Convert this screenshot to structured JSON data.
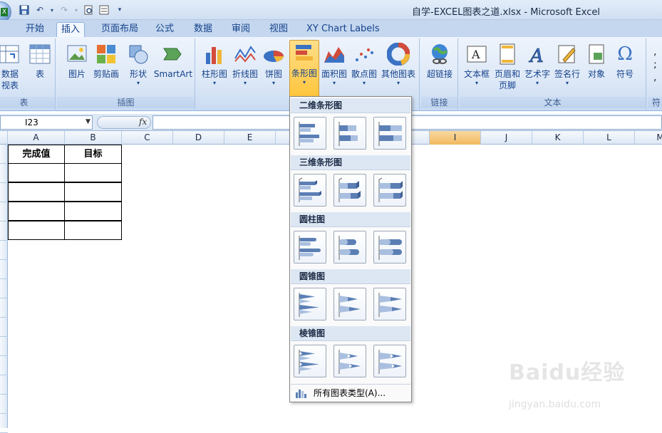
{
  "window": {
    "title": "自学-EXCEL图表之道.xlsx - Microsoft Excel"
  },
  "tabs": [
    "开始",
    "插入",
    "页面布局",
    "公式",
    "数据",
    "审阅",
    "视图",
    "XY Chart Labels"
  ],
  "active_tab": "插入",
  "ribbon": {
    "groups": {
      "table": "表",
      "illustrations": "插图",
      "links": "链接",
      "text": "文本"
    },
    "buttons": {
      "pivot_line1": "数据",
      "pivot_line2": "视表",
      "table": "表",
      "picture": "图片",
      "clipart": "剪贴画",
      "shapes": "形状",
      "smartart": "SmartArt",
      "column": "柱形图",
      "line": "折线图",
      "pie": "饼图",
      "bar": "条形图",
      "area": "面积图",
      "scatter": "散点图",
      "other": "其他图表",
      "hyperlink": "超链接",
      "textbox": "文本框",
      "header_footer_1": "页眉和",
      "header_footer_2": "页脚",
      "wordart": "艺术字",
      "signature": "签名行",
      "object": "对象",
      "symbol": "符号"
    },
    "group_cut": "符"
  },
  "formula_bar": {
    "name_box": "I23",
    "fx": "fx",
    "formula": ""
  },
  "columns": [
    "A",
    "B",
    "C",
    "D",
    "E",
    "I",
    "J",
    "K",
    "L",
    "M"
  ],
  "selected_column": "I",
  "table": {
    "headers": [
      "完成值",
      "目标"
    ],
    "rows": [
      [
        "",
        ""
      ],
      [
        "",
        ""
      ],
      [
        "",
        ""
      ],
      [
        "",
        ""
      ]
    ]
  },
  "dropdown": {
    "sections": [
      "二维条形图",
      "三维条形图",
      "圆柱图",
      "圆锥图",
      "棱锥图"
    ],
    "footer": "所有图表类型(A)..."
  },
  "watermark": {
    "text": "Baidu经验",
    "sub": "jingyan.baidu.com"
  }
}
